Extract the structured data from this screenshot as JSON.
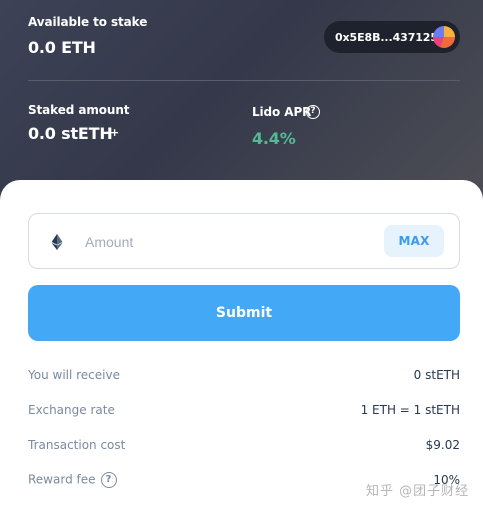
{
  "header": {
    "available_label": "Available to stake",
    "available_value": "0.0 ETH",
    "wallet_address": "0x5E8B...437125",
    "staked_label": "Staked amount",
    "staked_value": "0.0 stETH",
    "add_symbol": "+",
    "apr_label": "Lido APR",
    "apr_value": "4.4%",
    "help_symbol": "?"
  },
  "form": {
    "amount_placeholder": "Amount",
    "amount_value": "",
    "max_label": "MAX",
    "submit_label": "Submit"
  },
  "details": [
    {
      "label": "You will receive",
      "value": "0 stETH"
    },
    {
      "label": "Exchange rate",
      "value": "1 ETH = 1 stETH"
    },
    {
      "label": "Transaction cost",
      "value": "$9.02"
    },
    {
      "label": "Reward fee",
      "value": "10%"
    }
  ],
  "watermark": "知乎 @团子财经",
  "colors": {
    "accent": "#43a8f5",
    "apr_green": "#53ba95",
    "header_bg": "#3e4256"
  },
  "icons": [
    "ethereum-icon",
    "help-icon",
    "plus-icon",
    "wallet-avatar-icon"
  ]
}
